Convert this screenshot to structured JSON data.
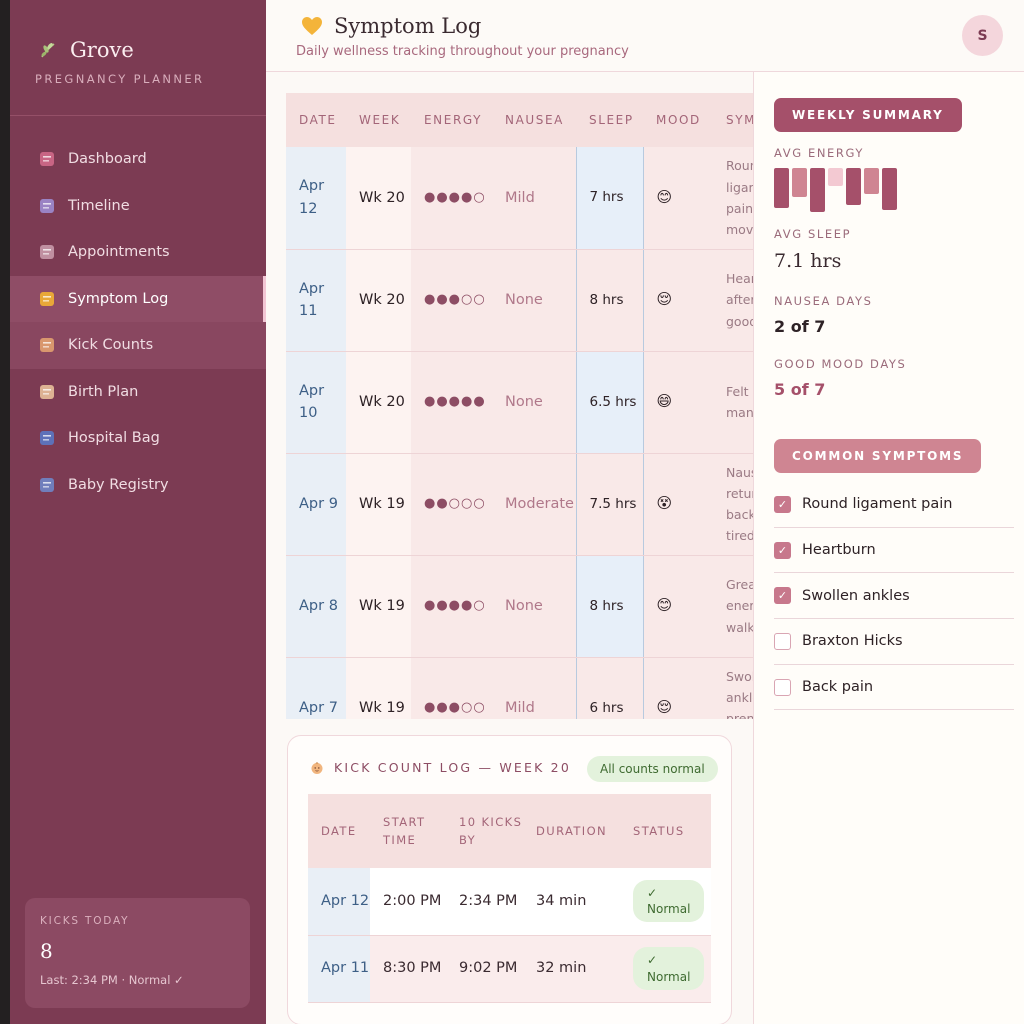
{
  "sidebar": {
    "brand_name": "Grove",
    "brand_sub": "PREGNANCY PLANNER",
    "nav": [
      {
        "label": "Dashboard",
        "icon": "bar-chart-icon",
        "color": "#d06a8a"
      },
      {
        "label": "Timeline",
        "icon": "calendar-icon",
        "color": "#9d8cd0"
      },
      {
        "label": "Appointments",
        "icon": "hospital-icon",
        "color": "#c89aaa"
      },
      {
        "label": "Symptom Log",
        "icon": "yellow-heart-icon",
        "color": "#f2b233"
      },
      {
        "label": "Kick Counts",
        "icon": "baby-icon",
        "color": "#e2a070"
      },
      {
        "label": "Birth Plan",
        "icon": "memo-icon",
        "color": "#e8c09a"
      },
      {
        "label": "Hospital Bag",
        "icon": "luggage-icon",
        "color": "#5a78c4"
      },
      {
        "label": "Baby Registry",
        "icon": "gift-boxes-icon",
        "color": "#6f86c8"
      }
    ],
    "kicks_card": {
      "label": "KICKS TODAY",
      "value": "8",
      "sub": "Last: 2:34 PM · Normal ✓"
    }
  },
  "header": {
    "title": "Symptom Log",
    "subtitle": "Daily wellness tracking throughout your pregnancy",
    "avatar_initial": "S"
  },
  "symptom_table": {
    "columns": [
      "DATE",
      "WEEK",
      "ENERGY",
      "NAUSEA",
      "SLEEP",
      "MOOD",
      "SYMPTOMS / NOTES"
    ],
    "rows": [
      {
        "date": "Apr 12",
        "week": "Wk 20",
        "energy": "●●●●○",
        "nausea": "Mild",
        "sleep": "7 hrs",
        "mood": "😊",
        "notes": "Round ligament pain, moving"
      },
      {
        "date": "Apr 11",
        "week": "Wk 20",
        "energy": "●●●○○",
        "nausea": "None",
        "sleep": "8 hrs",
        "mood": "😌",
        "notes": "Heartburn after dinner, good overall"
      },
      {
        "date": "Apr 10",
        "week": "Wk 20",
        "energy": "●●●●●",
        "nausea": "None",
        "sleep": "6.5 hrs",
        "mood": "😄",
        "notes": "Felt kicks many times"
      },
      {
        "date": "Apr 9",
        "week": "Wk 19",
        "energy": "●●○○○",
        "nausea": "Moderate",
        "sleep": "7.5 hrs",
        "mood": "😵",
        "notes": "Nausea returned, back pain, tired"
      },
      {
        "date": "Apr 8",
        "week": "Wk 19",
        "energy": "●●●●○",
        "nausea": "None",
        "sleep": "8 hrs",
        "mood": "😊",
        "notes": "Great energy, walk"
      },
      {
        "date": "Apr 7",
        "week": "Wk 19",
        "energy": "●●●○○",
        "nausea": "Mild",
        "sleep": "6 hrs",
        "mood": "😌",
        "notes": "Swollen ankles, prenatal yoga"
      }
    ]
  },
  "kick_log": {
    "title": "KICK COUNT LOG — WEEK 20",
    "badge": "All counts normal",
    "columns": [
      "DATE",
      "START TIME",
      "10 KICKS BY",
      "DURATION",
      "STATUS"
    ],
    "rows": [
      {
        "date": "Apr 12",
        "start": "2:00 PM",
        "by": "2:34 PM",
        "duration": "34 min",
        "status": "✓ Normal"
      },
      {
        "date": "Apr 11",
        "start": "8:30 PM",
        "by": "9:02 PM",
        "duration": "32 min",
        "status": "✓ Normal"
      }
    ]
  },
  "right_panel": {
    "summary_button": "WEEKLY SUMMARY",
    "avg_energy_label": "AVG ENERGY",
    "avg_energy_bars": [
      {
        "level": 0.9,
        "color": "#a5506a"
      },
      {
        "level": 0.65,
        "color": "#cf8592"
      },
      {
        "level": 1.0,
        "color": "#a5506a"
      },
      {
        "level": 0.4,
        "color": "#f3c9d2"
      },
      {
        "level": 0.85,
        "color": "#a5506a"
      },
      {
        "level": 0.6,
        "color": "#cf8592"
      },
      {
        "level": 0.95,
        "color": "#a5506a"
      }
    ],
    "avg_sleep_label": "AVG SLEEP",
    "avg_sleep_value": "7.1 hrs",
    "nausea_days_label": "NAUSEA DAYS",
    "nausea_days_value": "2 of 7",
    "good_mood_label": "GOOD MOOD DAYS",
    "good_mood_value": "5 of 7",
    "common_button": "COMMON SYMPTOMS",
    "symptoms": [
      {
        "label": "Round ligament pain",
        "checked": true
      },
      {
        "label": "Heartburn",
        "checked": true
      },
      {
        "label": "Swollen ankles",
        "checked": true
      },
      {
        "label": "Braxton Hicks",
        "checked": false
      },
      {
        "label": "Back pain",
        "checked": false
      }
    ]
  },
  "colors": {
    "sidebar_bg": "#7c3b53",
    "accent": "#a5506a",
    "accent_light": "#cf8592",
    "date_cell": "#e9eff6",
    "status_green_bg": "#e3f2dc"
  }
}
